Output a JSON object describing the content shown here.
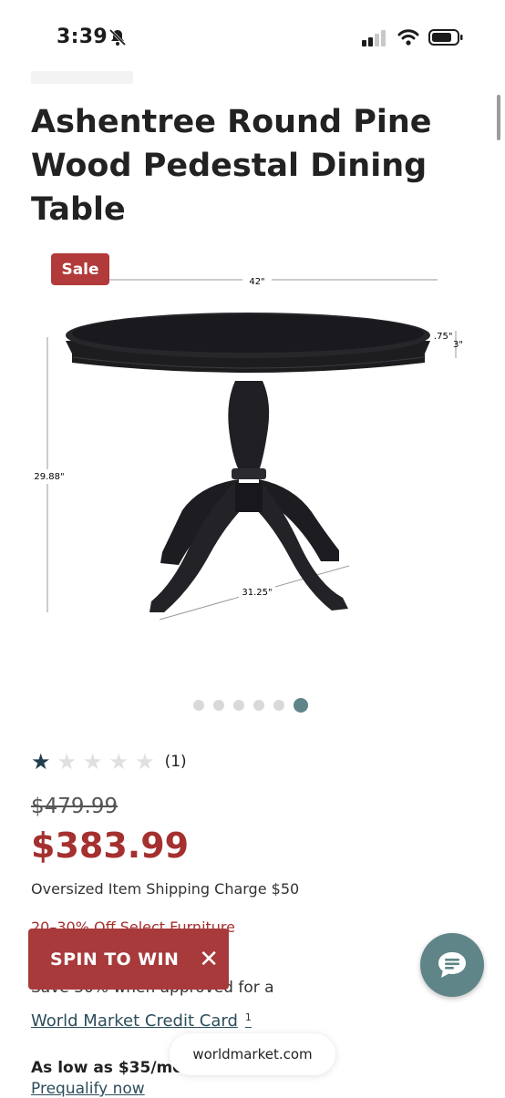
{
  "status_bar": {
    "time": "3:39"
  },
  "product": {
    "title": "Ashentree Round Pine Wood Pedestal Dining Table",
    "sale_badge": "Sale",
    "dimensions": {
      "width": "42\"",
      "height": "29.88\"",
      "base": "31.25\"",
      "top_edge": ".75\"",
      "apron": "3\""
    }
  },
  "gallery": {
    "dot_count": 6,
    "active_index": 5
  },
  "rating": {
    "stars": 1,
    "max": 5,
    "count_label": "(1)"
  },
  "pricing": {
    "original": "$479.99",
    "sale": "$383.99",
    "shipping": "Oversized Item Shipping Charge $50",
    "promo": "20–30% Off Select Furniture"
  },
  "spin": {
    "label": "SPIN TO WIN",
    "close_symbol": "✕"
  },
  "credit": {
    "line1": "Save 30% when approved for a",
    "link": "World Market Credit Card",
    "footnote": "1"
  },
  "financing": {
    "as_low": "As low as $35/mo",
    "prequalify": "Prequalify now"
  },
  "browser": {
    "url": "worldmarket.com"
  },
  "colors": {
    "sale_red": "#b23a3a",
    "price_red": "#a4302f",
    "teal": "#5f8588"
  },
  "icons": {
    "bell": "bell-slash-icon",
    "signal": "signal-icon",
    "wifi": "wifi-icon",
    "battery": "battery-icon",
    "chat": "chat-icon",
    "close": "close-icon"
  }
}
